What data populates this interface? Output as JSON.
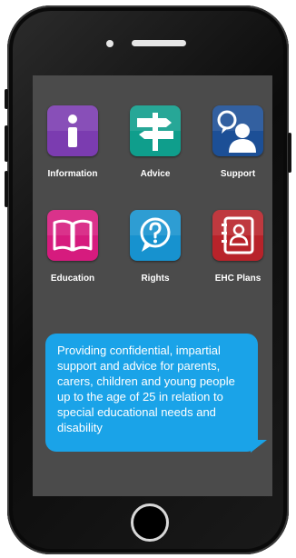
{
  "apps": [
    {
      "label": "Information",
      "icon": "info-icon",
      "color": "#7b3cb0"
    },
    {
      "label": "Advice",
      "icon": "signpost-icon",
      "color": "#0f9e8c"
    },
    {
      "label": "Support",
      "icon": "person-chat-icon",
      "color": "#1c4f96"
    },
    {
      "label": "Education",
      "icon": "open-book-icon",
      "color": "#d61b7e"
    },
    {
      "label": "Rights",
      "icon": "question-bubble-icon",
      "color": "#1792cf"
    },
    {
      "label": "EHC Plans",
      "icon": "contact-book-icon",
      "color": "#b8232a"
    }
  ],
  "message": {
    "text": "Providing confidential, impartial support and advice for parents, carers, children and young people up to the age of 25 in relation to special educational needs and disability",
    "color": "#1aa3e8"
  },
  "colors": {
    "screen": "#4b4b4b",
    "phone_frame": "#111111"
  }
}
